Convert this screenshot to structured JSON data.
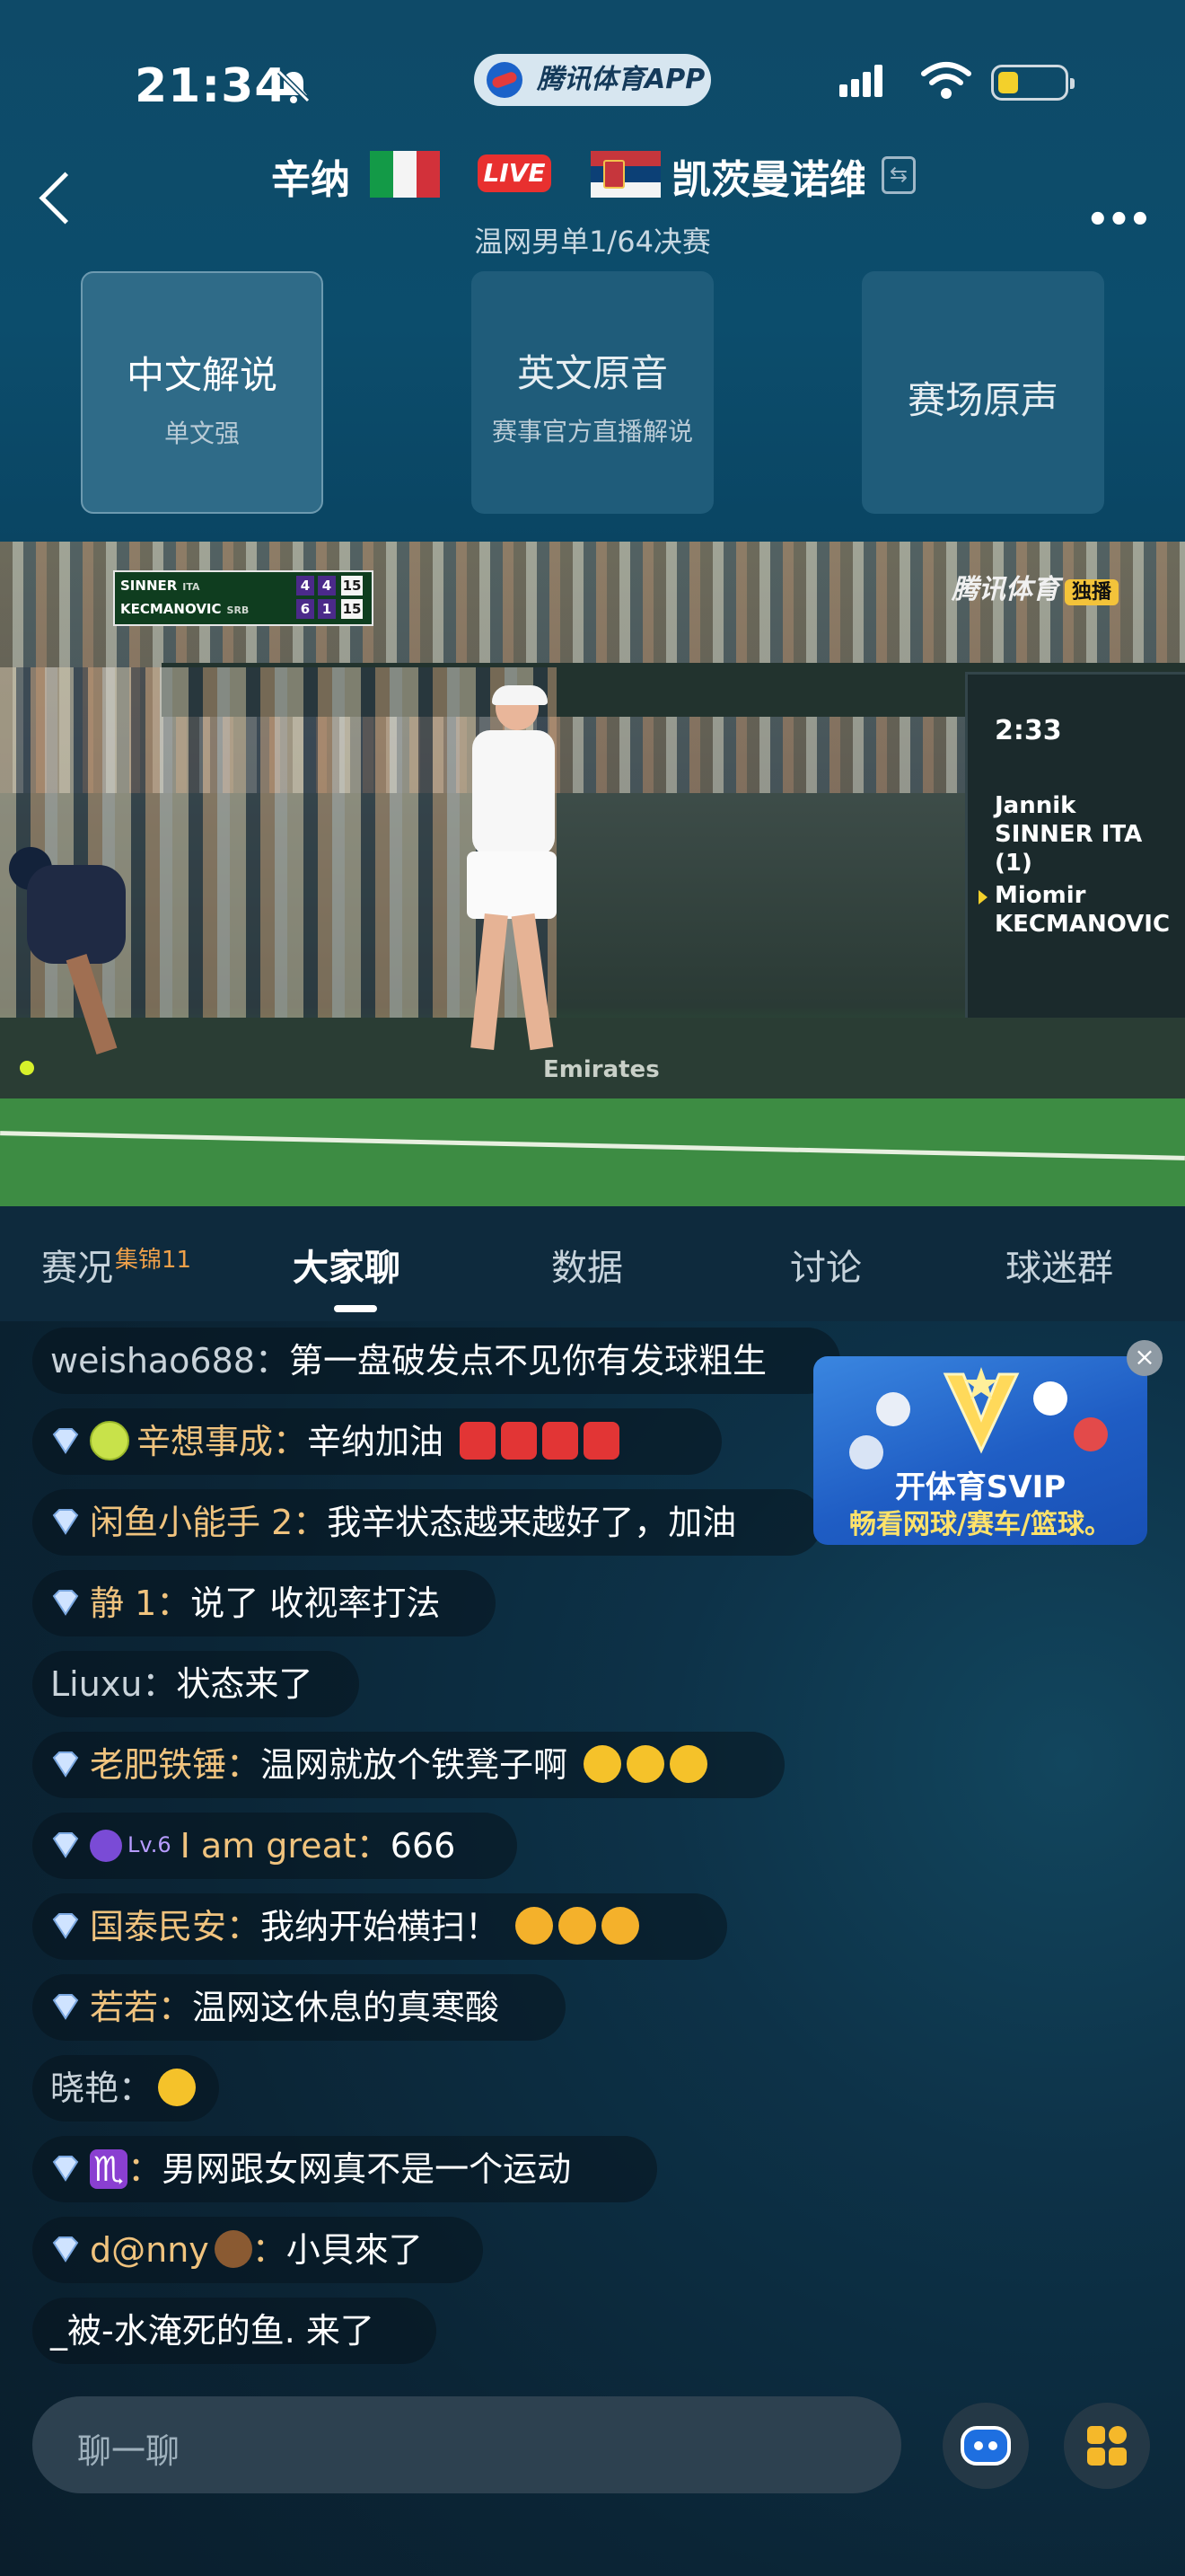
{
  "status_bar": {
    "time": "21:34",
    "app_pill": "腾讯体育APP"
  },
  "header": {
    "player1": "辛纳",
    "live": "LIVE",
    "player2": "凯茨曼诺维",
    "round": "温网男单1/64决赛"
  },
  "commentary": [
    {
      "title": "中文解说",
      "sub": "单文强"
    },
    {
      "title": "英文原音",
      "sub": "赛事官方直播解说"
    },
    {
      "title": "赛场原声",
      "sub": ""
    }
  ],
  "video": {
    "scoreboard": [
      {
        "name": "SINNER",
        "nat": "ITA",
        "sets": "4",
        "games": "4",
        "points": "15"
      },
      {
        "name": "KECMANOVIC",
        "nat": "SRB",
        "sets": "6",
        "games": "1",
        "points": "15"
      }
    ],
    "watermark": "腾讯体育",
    "watermark_tag": "独播",
    "board_time": "2:33",
    "board_p1_first": "Jannik",
    "board_p1_last": "SINNER ITA (1)",
    "board_p2_first": "Miomir",
    "board_p2_last": "KECMANOVIC",
    "court_ad": "Emirates"
  },
  "tabs": [
    {
      "label": "赛况",
      "sup": "集锦11"
    },
    {
      "label": "大家聊"
    },
    {
      "label": "数据"
    },
    {
      "label": "讨论"
    },
    {
      "label": "球迷群"
    }
  ],
  "chat": [
    {
      "user": "weishao688",
      "text": "第一盘破发点不见你有发球粗生"
    },
    {
      "user": "辛想事成",
      "text": "辛纳加油"
    },
    {
      "user": "闲鱼小能手 2",
      "text": "我辛状态越来越好了，加油"
    },
    {
      "user": "静 1",
      "text": "说了 收视率打法"
    },
    {
      "user": "Liuxu",
      "text": "状态来了"
    },
    {
      "user": "老肥铁锤",
      "text": "温网就放个铁凳子啊"
    },
    {
      "user": "I am great",
      "level": "Lv.6",
      "text": "666"
    },
    {
      "user": "国泰民安",
      "text": "我纳开始横扫！"
    },
    {
      "user": "若若",
      "text": "温网这休息的真寒酸"
    },
    {
      "user": "晓艳",
      "text": ""
    },
    {
      "user": "♏",
      "text": "男网跟女网真不是一个运动"
    },
    {
      "user": "d@nny",
      "text": "小貝來了"
    },
    {
      "user": "_被-水淹死的鱼.",
      "text": "来了"
    }
  ],
  "promo": {
    "line1": "开体育SVIP",
    "line2": "畅看网球/赛车/篮球。"
  },
  "input": {
    "placeholder": "聊一聊"
  },
  "colors": {
    "accent_gold": "#f0c37e",
    "live_red": "#e8302f",
    "header_bg": "#0e4a68"
  }
}
